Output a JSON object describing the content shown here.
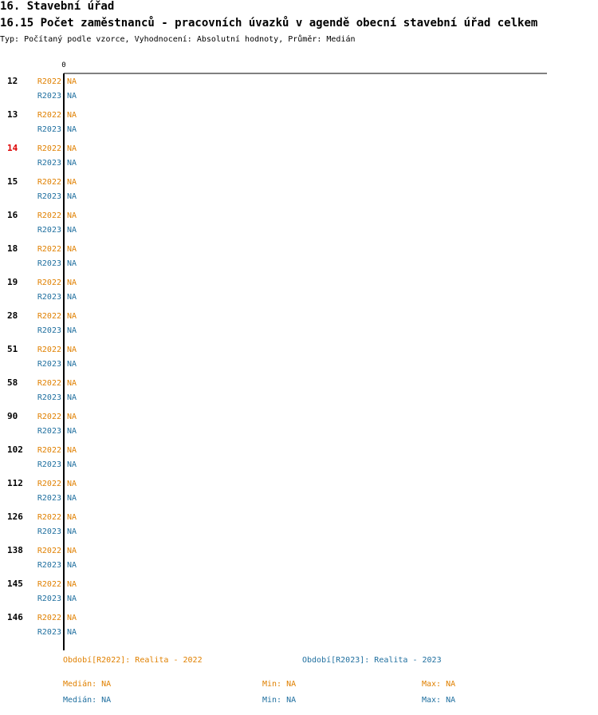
{
  "header": {
    "title": "16. Stavební úřad",
    "subtitle": "16.15 Počet zaměstnanců - pracovních úvazků v agendě obecní stavební úřad celkem",
    "type_line": "Typ: Počítaný podle vzorce, Vyhodnocení: Absolutní hodnoty, Průměr: Medián"
  },
  "colors": {
    "r2022": "#e08000",
    "r2023": "#1f6f9f",
    "highlight": "#dd0000",
    "text": "#000000"
  },
  "chart_data": {
    "type": "bar",
    "orientation": "horizontal",
    "x_tick_labels": [
      "0"
    ],
    "highlight_category": "14",
    "categories": [
      "12",
      "13",
      "14",
      "15",
      "16",
      "18",
      "19",
      "28",
      "51",
      "58",
      "90",
      "102",
      "112",
      "126",
      "138",
      "145",
      "146"
    ],
    "series": [
      {
        "name": "R2022",
        "values": [
          null,
          null,
          null,
          null,
          null,
          null,
          null,
          null,
          null,
          null,
          null,
          null,
          null,
          null,
          null,
          null,
          null
        ],
        "labels": [
          "NA",
          "NA",
          "NA",
          "NA",
          "NA",
          "NA",
          "NA",
          "NA",
          "NA",
          "NA",
          "NA",
          "NA",
          "NA",
          "NA",
          "NA",
          "NA",
          "NA"
        ]
      },
      {
        "name": "R2023",
        "values": [
          null,
          null,
          null,
          null,
          null,
          null,
          null,
          null,
          null,
          null,
          null,
          null,
          null,
          null,
          null,
          null,
          null
        ],
        "labels": [
          "NA",
          "NA",
          "NA",
          "NA",
          "NA",
          "NA",
          "NA",
          "NA",
          "NA",
          "NA",
          "NA",
          "NA",
          "NA",
          "NA",
          "NA",
          "NA",
          "NA"
        ]
      }
    ]
  },
  "legend": {
    "period_r2022": "Období[R2022]: Realita - 2022",
    "period_r2023": "Období[R2023]: Realita - 2023",
    "r2022": {
      "median": "Medián: NA",
      "min": "Min: NA",
      "max": "Max: NA"
    },
    "r2023": {
      "median": "Medián: NA",
      "min": "Min: NA",
      "max": "Max: NA"
    }
  }
}
